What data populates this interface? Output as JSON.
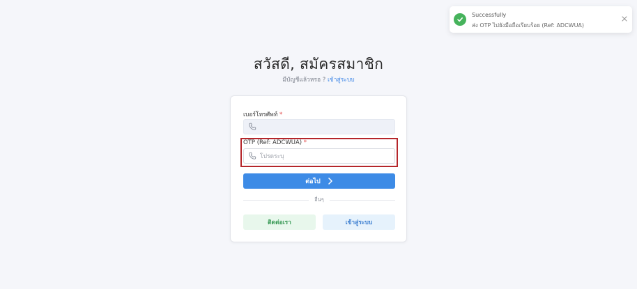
{
  "header": {
    "title": "สวัสดี, สมัครสมาชิก",
    "subtitle_prefix": "มีบัญชีแล้วหรอ ? ",
    "login_link": "เข้าสู่ระบบ"
  },
  "form": {
    "phone": {
      "label": "เบอร์โทรศัพท์",
      "required_mark": "*",
      "icon": "phone-icon",
      "value": ""
    },
    "otp": {
      "label": "OTP (Ref: ADCWUA)",
      "required_mark": "*",
      "icon": "phone-icon",
      "placeholder": "โปรดระบุ"
    },
    "next_button": "ต่อไป",
    "divider_text": "อื่นๆ",
    "contact_button": "ติดต่อเรา",
    "login_button": "เข้าสู่ระบบ"
  },
  "toast": {
    "icon": "check-circle-icon",
    "title": "Successfully",
    "message": "ส่ง OTP ไปยังมือถือเรียบร้อย (Ref: ADCWUA)",
    "close_icon": "close-icon"
  },
  "colors": {
    "primary": "#3d8be6",
    "success": "#46b35c",
    "highlight": "#b5262b",
    "background": "#f5f6fa"
  }
}
